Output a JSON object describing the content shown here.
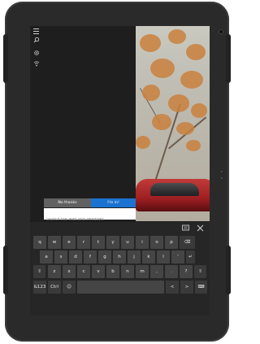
{
  "start": {
    "rail_icons": [
      "hamburger-icon",
      "search-icon",
      "settings-icon",
      "network-icon"
    ]
  },
  "cortana": {
    "no_thanks_label": "No thanks",
    "im_in_label": "I'm in!",
    "search_placeholder": "Search the web and Windows"
  },
  "keyboard": {
    "tools": [
      "keyboard-settings-icon",
      "close-icon"
    ],
    "row1": [
      "q",
      "w",
      "e",
      "r",
      "t",
      "y",
      "u",
      "i",
      "o",
      "p",
      "⌫"
    ],
    "row2": [
      "a",
      "s",
      "d",
      "f",
      "g",
      "h",
      "j",
      "k",
      "l",
      "'",
      "↵"
    ],
    "row3": [
      "⇧",
      "z",
      "x",
      "c",
      "v",
      "b",
      "n",
      "m",
      ",",
      ".",
      "?",
      "⇧"
    ],
    "row4_left": [
      "&123",
      "Ctrl",
      "☺"
    ],
    "row4_right": [
      "<",
      ">",
      "⌨"
    ]
  },
  "colors": {
    "accent": "#1a73d1",
    "frame": "#2a2a2a"
  }
}
